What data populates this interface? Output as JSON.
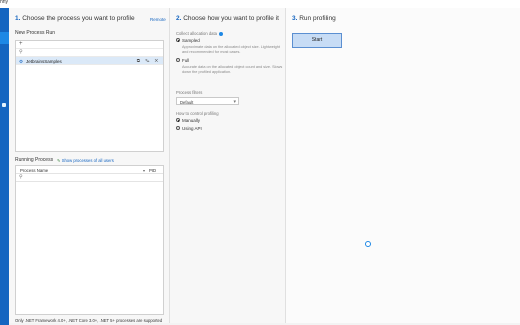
{
  "window": {
    "title_fragment": "nny"
  },
  "step1": {
    "num": "1.",
    "title": "Choose the process you want to profile",
    "remote_link": "Remote",
    "new_process_label": "New Process Run",
    "add_glyph": "+",
    "search_glyph": "⚲",
    "run_item": {
      "name": "JetbrainsSamples",
      "actions": "⧉ ✎ ✕"
    },
    "running_label": "Running Process",
    "show_all": "Show processes of all users",
    "columns": {
      "process": "Process Name",
      "pid": "PID"
    },
    "footnote": "Only .NET Framework 4.0+, .NET Core 3.0+, .NET 5+ processes are supported"
  },
  "step2": {
    "num": "2.",
    "title": "Choose how you want to profile it",
    "alloc_label": "Collect allocation data",
    "sampled": {
      "label": "Sampled",
      "desc": "Approximate data on the allocated object size. Lightweight and recommended for most cases."
    },
    "full": {
      "label": "Full",
      "desc": "Accurate data on the allocated object count and size. Slows down the profiled application."
    },
    "filters_label": "Process filters",
    "filter_value": "Default",
    "control_label": "How to control profiling",
    "manually": "Manually",
    "using_api": "Using API"
  },
  "step3": {
    "num": "3.",
    "title": "Run profiling",
    "start": "Start"
  },
  "colors": {
    "accent": "#1565c0",
    "nav": "#1565c0",
    "selected_row": "#dbe9f8",
    "start_fill": "#c7dcf5"
  },
  "icons": [
    "plus-icon",
    "search-icon",
    "settings-icon",
    "edit-icon",
    "close-icon",
    "info-icon",
    "loading-spinner-icon"
  ]
}
